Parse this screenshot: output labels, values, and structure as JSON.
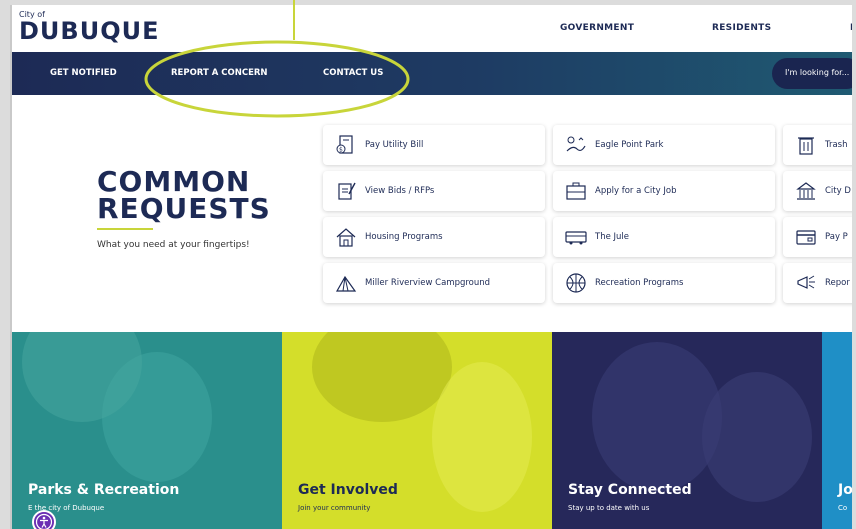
{
  "header": {
    "logo_small": "City of",
    "logo_big": "DUBUQUE",
    "nav": [
      "GOVERNMENT",
      "RESIDENTS",
      "I"
    ]
  },
  "navbar": {
    "links": [
      "GET NOTIFIED",
      "REPORT A CONCERN",
      "CONTACT US"
    ],
    "search_placeholder": "I'm looking for..."
  },
  "common_requests": {
    "title_line1": "COMMON",
    "title_line2": "REQUESTS",
    "subtitle": "What you need at your fingertips!",
    "col1": [
      "Pay Utility Bill",
      "View Bids / RFPs",
      "Housing Programs",
      "Miller Riverview Campground"
    ],
    "col2": [
      "Eagle Point Park",
      "Apply for a City Job",
      "The Jule",
      "Recreation Programs"
    ],
    "col3": [
      "Trash",
      "City D",
      "Pay P",
      "Repor"
    ]
  },
  "promos": [
    {
      "title": "Parks & Recreation",
      "sub": "the city of Dubuque",
      "sub_prefix": "E"
    },
    {
      "title": "Get Involved",
      "sub": "Join your community"
    },
    {
      "title": "Stay Connected",
      "sub": "Stay up to date with us"
    },
    {
      "title": "Jo",
      "sub": "Co"
    }
  ],
  "colors": {
    "navy": "#1d2a55",
    "accent": "#c8d53a",
    "teal": "#2a8f8c",
    "yellow": "#d4de2a",
    "purple": "#26285a"
  }
}
